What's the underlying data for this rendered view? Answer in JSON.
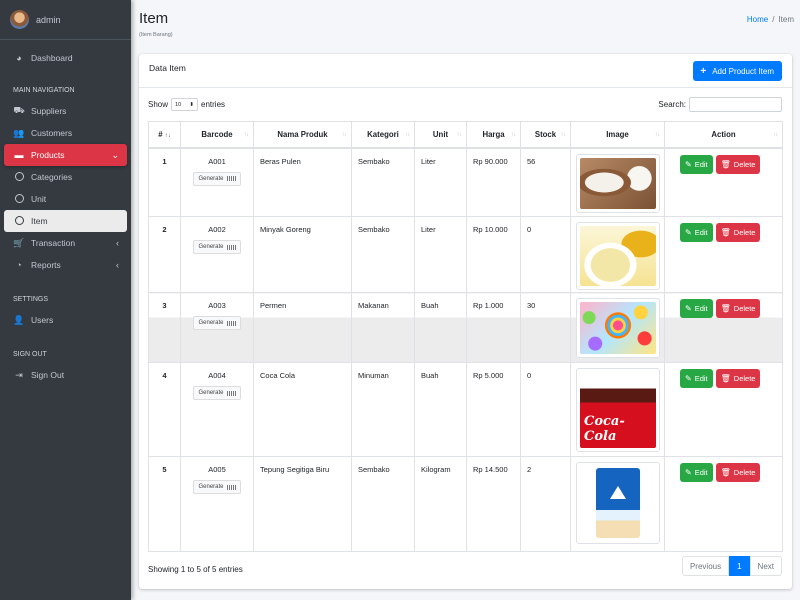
{
  "user": {
    "name": "admin"
  },
  "sidebar": {
    "dashboard": "Dashboard",
    "main_header": "MAIN NAVIGATION",
    "suppliers": "Suppliers",
    "customers": "Customers",
    "products": "Products",
    "categories": "Categories",
    "unit": "Unit",
    "item": "Item",
    "transaction": "Transaction",
    "reports": "Reports",
    "settings_header": "SETTINGS",
    "users": "Users",
    "signout_header": "SIGN OUT",
    "sign_out": "Sign Out"
  },
  "header": {
    "title": "Item",
    "subtitle": "(Item Barang)",
    "breadcrumb_home": "Home",
    "breadcrumb_sep": "/",
    "breadcrumb_current": "Item"
  },
  "card": {
    "title": "Data Item",
    "add_button": "Add Product Item"
  },
  "table_controls": {
    "show": "Show",
    "entries_value": "10",
    "entries": "entries",
    "search_label": "Search:"
  },
  "columns": [
    "#",
    "Barcode",
    "Nama Produk",
    "Kategori",
    "Unit",
    "Harga",
    "Stock",
    "Image",
    "Action"
  ],
  "rows": [
    {
      "no": "1",
      "barcode": "A001",
      "name": "Beras Pulen",
      "category": "Sembako",
      "unit": "Liter",
      "price": "Rp 90.000",
      "stock": "56",
      "image": "rice"
    },
    {
      "no": "2",
      "barcode": "A002",
      "name": "Minyak Goreng",
      "category": "Sembako",
      "unit": "Liter",
      "price": "Rp 10.000",
      "stock": "0",
      "image": "oil"
    },
    {
      "no": "3",
      "barcode": "A003",
      "name": "Permen",
      "category": "Makanan",
      "unit": "Buah",
      "price": "Rp 1.000",
      "stock": "30",
      "image": "candy"
    },
    {
      "no": "4",
      "barcode": "A004",
      "name": "Coca Cola",
      "category": "Minuman",
      "unit": "Buah",
      "price": "Rp 5.000",
      "stock": "0",
      "image": "coke",
      "image_text": "Coca-Cola"
    },
    {
      "no": "5",
      "barcode": "A005",
      "name": "Tepung Segitiga Biru",
      "category": "Sembako",
      "unit": "Kilogram",
      "price": "Rp 14.500",
      "stock": "2",
      "image": "flour"
    }
  ],
  "row_buttons": {
    "generate": "Generate",
    "edit": "Edit",
    "delete": "Delete"
  },
  "footer": {
    "info": "Showing 1 to 5 of 5 entries",
    "previous": "Previous",
    "page": "1",
    "next": "Next"
  },
  "colors": {
    "sidebar_bg": "#343a40",
    "active_red": "#dc3545",
    "primary": "#007bff",
    "success": "#28a745"
  }
}
